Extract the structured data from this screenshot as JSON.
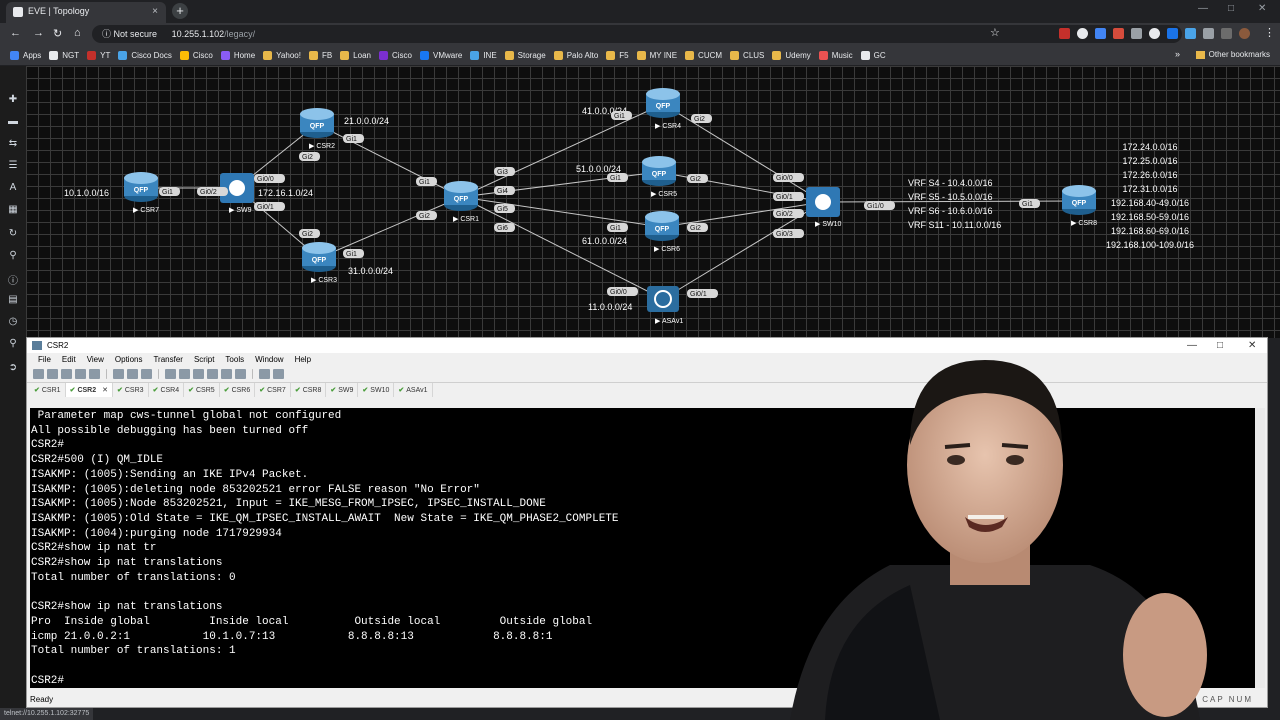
{
  "browser": {
    "tab_title": "EVE | Topology",
    "tab_close": "×",
    "new_tab": "+",
    "security_label": "Not secure",
    "url_host": "10.255.1.102",
    "url_path": "/legacy/",
    "bookmarks": [
      "Apps",
      "NGT",
      "YT",
      "Cisco Docs",
      "Cisco",
      "Home",
      "Yahoo!",
      "FB",
      "Loan",
      "Cisco",
      "VMware",
      "INE",
      "Storage",
      "Palo Alto",
      "F5",
      "MY INE",
      "CUCM",
      "CLUS",
      "Udemy",
      "Music",
      "GC"
    ],
    "other_bookmarks": "Other bookmarks",
    "bookmarks_more": "»",
    "bookmark_colors": [
      "#4285f4",
      "#e8eaed",
      "#c4302b",
      "#4aa4e8",
      "#fbbc05",
      "#8a5cf6",
      "#e8b84a",
      "#e8b84a",
      "#e8b84a",
      "#7b2fd0",
      "#1877f2",
      "#4aa4e8",
      "#e8b84a",
      "#e8b84a",
      "#e8b84a",
      "#e8b84a",
      "#e8b84a",
      "#e8b84a",
      "#e8b84a",
      "#ec5252",
      "#e8eaed"
    ],
    "status_url": "telnet://10.255.1.102:32775"
  },
  "topology": {
    "nodes": [
      {
        "id": "CSR7",
        "label": "CSR7",
        "type": "router"
      },
      {
        "id": "SW9",
        "label": "SW9",
        "type": "switch"
      },
      {
        "id": "CSR2",
        "label": "CSR2",
        "type": "router"
      },
      {
        "id": "CSR3",
        "label": "CSR3",
        "type": "router"
      },
      {
        "id": "CSR1",
        "label": "CSR1",
        "type": "router"
      },
      {
        "id": "CSR4",
        "label": "CSR4",
        "type": "router"
      },
      {
        "id": "CSR5",
        "label": "CSR5",
        "type": "router"
      },
      {
        "id": "CSR6",
        "label": "CSR6",
        "type": "router"
      },
      {
        "id": "ASAv1",
        "label": "ASAv1",
        "type": "firewall"
      },
      {
        "id": "SW10",
        "label": "SW10",
        "type": "switch"
      },
      {
        "id": "CSR8",
        "label": "CSR8",
        "type": "router"
      }
    ],
    "subnets": [
      "10.1.0.0/16",
      "172.16.1.0/24",
      "21.0.0.0/24",
      "31.0.0.0/24",
      "41.0.0.0/24",
      "51.0.0.0/24",
      "61.0.0.0/24",
      "11.0.0.0/24"
    ],
    "vrfs": [
      "VRF S4 - 10.4.0.0/16",
      "VRF S5 - 10.5.0.0/16",
      "VRF S6 - 10.6.0.0/16",
      "VRF S11 - 10.11.0.0/16"
    ],
    "csr8_routes": [
      "172.24.0.0/16",
      "172.25.0.0/16",
      "172.26.0.0/16",
      "172.31.0.0/16",
      "192.168.40-49.0/16",
      "192.168.50-59.0/16",
      "192.168.60-69.0/16",
      "192.168.100-109.0/16"
    ],
    "interfaces": [
      "Gi1",
      "Gi2",
      "Gi3",
      "Gi4",
      "Gi5",
      "Gi6",
      "Gi0/0",
      "Gi0/1",
      "Gi0/2",
      "Gi0/3",
      "Gi1/0"
    ],
    "router_badge": "QFP"
  },
  "securecrt": {
    "window_title": "CSR2",
    "menu": [
      "File",
      "Edit",
      "View",
      "Options",
      "Transfer",
      "Script",
      "Tools",
      "Window",
      "Help"
    ],
    "session_tabs": [
      "CSR1",
      "CSR2",
      "CSR3",
      "CSR4",
      "CSR5",
      "CSR6",
      "CSR7",
      "CSR8",
      "SW9",
      "SW10",
      "ASAv1"
    ],
    "active_tab": "CSR2",
    "terminal_lines": [
      " Parameter map cws-tunnel global not configured",
      "All possible debugging has been turned off",
      "CSR2#",
      "CSR2#500 (I) QM_IDLE",
      "ISAKMP: (1005):Sending an IKE IPv4 Packet.",
      "ISAKMP: (1005):deleting node 853202521 error FALSE reason \"No Error\"",
      "ISAKMP: (1005):Node 853202521, Input = IKE_MESG_FROM_IPSEC, IPSEC_INSTALL_DONE",
      "ISAKMP: (1005):Old State = IKE_QM_IPSEC_INSTALL_AWAIT  New State = IKE_QM_PHASE2_COMPLETE",
      "ISAKMP: (1004):purging node 1717929934",
      "CSR2#show ip nat tr",
      "CSR2#show ip nat translations",
      "Total number of translations: 0",
      "",
      "CSR2#show ip nat translations",
      "Pro  Inside global         Inside local          Outside local         Outside global",
      "icmp 21.0.0.2:1           10.1.0.7:13           8.8.8.8:13            8.8.8.8:1",
      "Total number of translations: 1",
      "",
      "CSR2#"
    ],
    "status": "Ready",
    "caps": "CAP",
    "num": "NUM"
  }
}
